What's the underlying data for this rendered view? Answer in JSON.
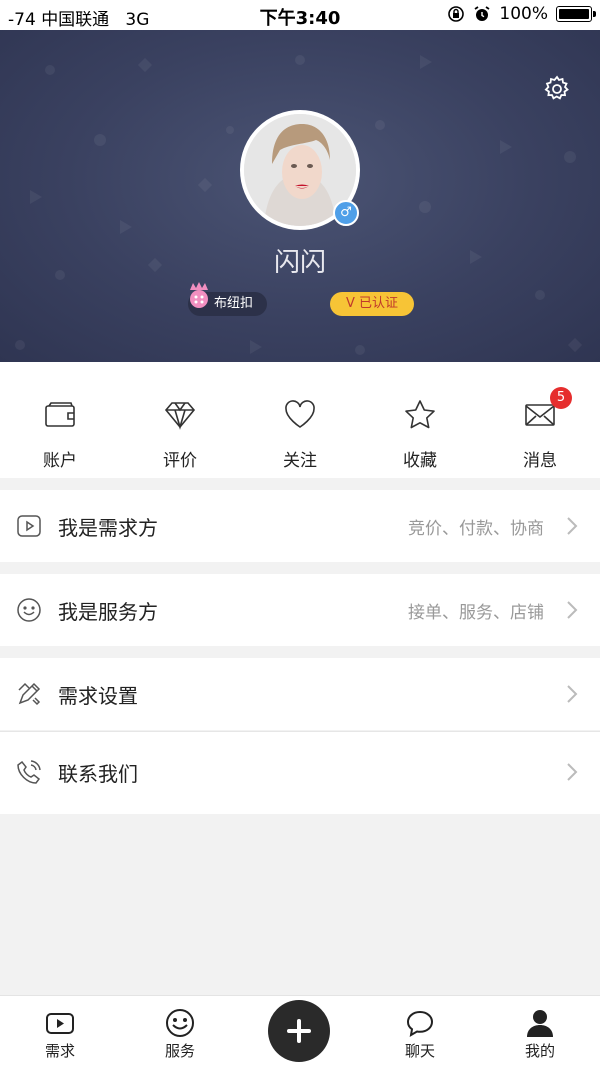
{
  "status_bar": {
    "signal": "-74",
    "carrier": "中国联通",
    "network": "3G",
    "time": "下午3:40",
    "battery": "100%"
  },
  "profile": {
    "name": "闪闪",
    "tag_label": "布纽扣",
    "verified_label": "V 已认证"
  },
  "quick_actions": [
    {
      "label": "账户",
      "icon": "wallet-icon"
    },
    {
      "label": "评价",
      "icon": "diamond-icon"
    },
    {
      "label": "关注",
      "icon": "heart-icon"
    },
    {
      "label": "收藏",
      "icon": "star-icon"
    },
    {
      "label": "消息",
      "icon": "envelope-icon",
      "badge": "5"
    }
  ],
  "menu": [
    {
      "title": "我是需求方",
      "subtitle": "竞价、付款、协商",
      "icon": "play-square-icon"
    },
    {
      "title": "我是服务方",
      "subtitle": "接单、服务、店铺",
      "icon": "smile-icon"
    },
    {
      "title": "需求设置",
      "subtitle": "",
      "icon": "pencil-ruler-icon"
    },
    {
      "title": "联系我们",
      "subtitle": "",
      "icon": "phone-icon"
    }
  ],
  "tabs": [
    {
      "label": "需求",
      "icon": "play-square-icon"
    },
    {
      "label": "服务",
      "icon": "smile-icon"
    },
    {
      "label": "聊天",
      "icon": "chat-bubble-icon"
    },
    {
      "label": "我的",
      "icon": "user-icon"
    }
  ],
  "colors": {
    "hero_bg": "#3a4160",
    "verified_bg": "#f7c436",
    "badge_red": "#e62e2e",
    "gender_blue": "#4f9fe8"
  }
}
